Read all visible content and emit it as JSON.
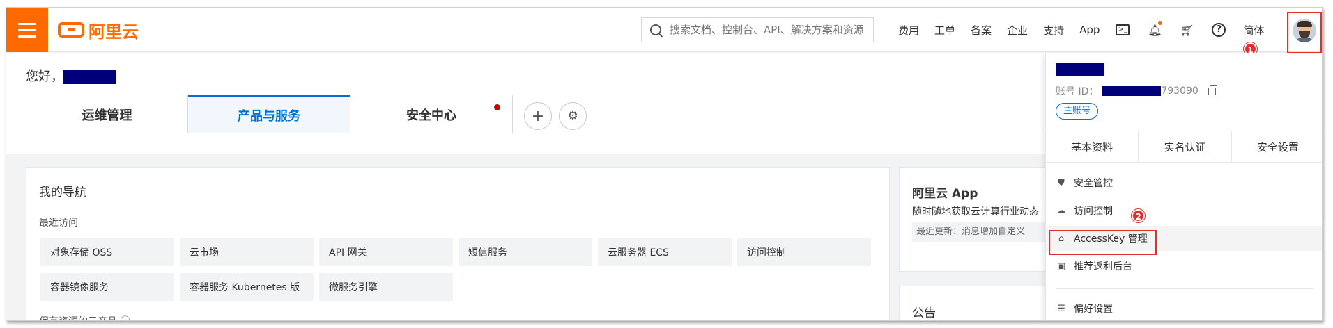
{
  "header": {
    "logo_text": "阿里云",
    "search_placeholder": "搜索文档、控制台、API、解决方案和资源",
    "nav_links": [
      "费用",
      "工单",
      "备案",
      "企业",
      "支持",
      "App"
    ],
    "lang": "简体",
    "brand_color": "#ff6a00"
  },
  "main": {
    "greeting": "您好，",
    "tabs": [
      "运维管理",
      "产品与服务",
      "安全中心"
    ],
    "active_tab": "产品与服务",
    "add_label": "+",
    "settings_label": "⚙"
  },
  "nav_card": {
    "title": "我的导航",
    "recent_label": "最近访问",
    "recent_items": [
      "对象存储 OSS",
      "云市场",
      "API 网关",
      "短信服务",
      "云服务器 ECS",
      "访问控制",
      "容器镜像服务",
      "容器服务 Kubernetes 版",
      "微服务引擎"
    ],
    "cutoff_text": "保有资源的云产品 ⓘ"
  },
  "app_card": {
    "title": "阿里云 App",
    "desc": "随时随地获取云计算行业动态",
    "update": "最近更新：消息增加自定义"
  },
  "notice_card": {
    "title": "公告"
  },
  "account_menu": {
    "id_label": "账号 ID：",
    "id_suffix": "793090",
    "role_pill": "主账号",
    "tabs": [
      "基本资料",
      "实名认证",
      "安全设置"
    ],
    "items": [
      {
        "icon": "shield-icon",
        "glyph": "⛊",
        "label": "安全管控"
      },
      {
        "icon": "cloud-icon",
        "glyph": "☁",
        "label": "访问控制"
      },
      {
        "icon": "key-icon",
        "glyph": "⌂",
        "label": "AccessKey 管理"
      },
      {
        "icon": "book-icon",
        "glyph": "▣",
        "label": "推荐返利后台"
      },
      {
        "icon": "sliders-icon",
        "glyph": "☰",
        "label": "偏好设置"
      }
    ],
    "highlight_color": "#e0302a"
  },
  "annotations": {
    "step1": "1",
    "step2": "2"
  }
}
